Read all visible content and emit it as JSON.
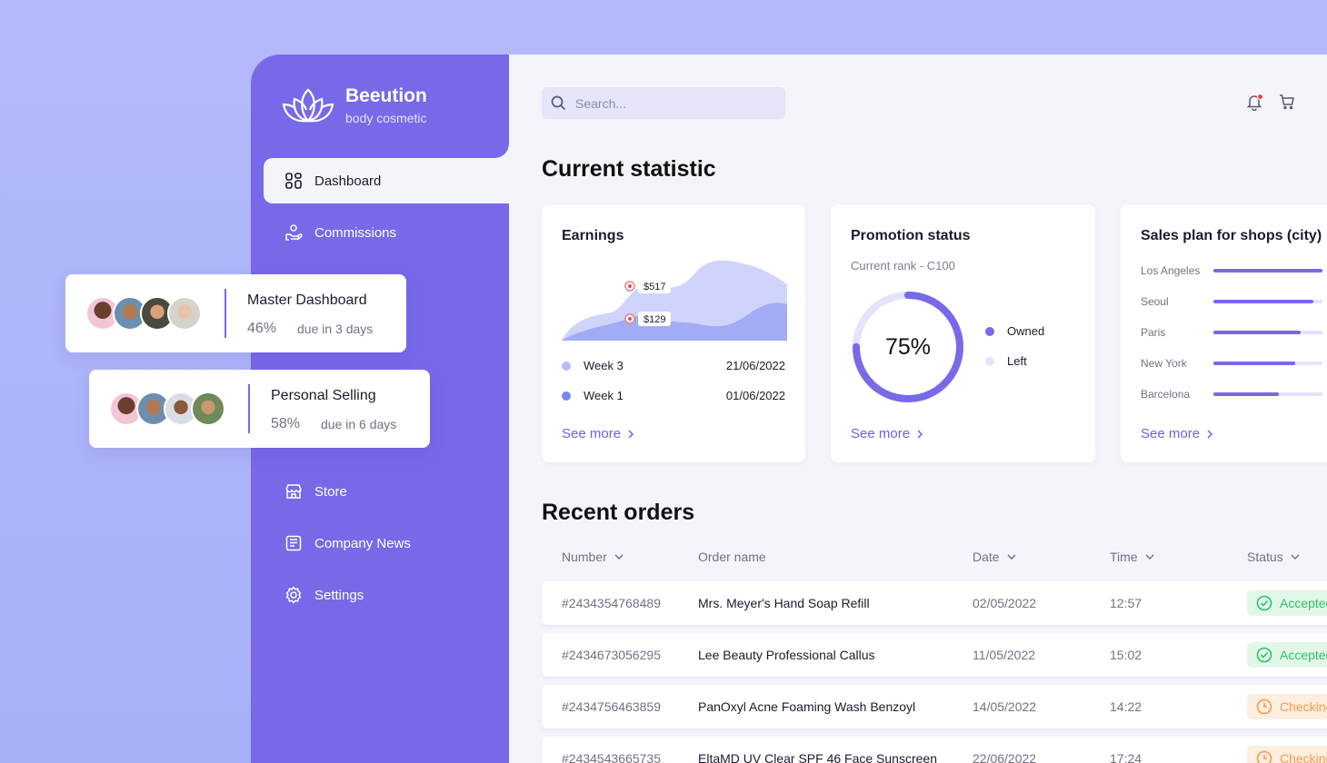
{
  "brand": {
    "name": "Beeution",
    "subtitle": "body cosmetic"
  },
  "sidebar": {
    "items": [
      {
        "label": "Dashboard",
        "icon": "grid-icon",
        "active": true
      },
      {
        "label": "Commissions",
        "icon": "hand-coins-icon"
      },
      {
        "label": "Store",
        "icon": "store-icon"
      },
      {
        "label": "Company News",
        "icon": "newspaper-icon"
      },
      {
        "label": "Settings",
        "icon": "gear-icon"
      }
    ]
  },
  "search": {
    "placeholder": "Search..."
  },
  "sections": {
    "statistic": "Current statistic",
    "orders": "Recent orders"
  },
  "earnings": {
    "title": "Earnings",
    "markers": [
      "$517",
      "$129"
    ],
    "legend": [
      {
        "label": "Week 3",
        "date": "21/06/2022",
        "color": "#b5bdf8"
      },
      {
        "label": "Week 1",
        "date": "01/06/2022",
        "color": "#7b86ee"
      }
    ],
    "see_more": "See more"
  },
  "promotion": {
    "title": "Promotion status",
    "subtitle": "Current rank - C100",
    "value_label": "75%",
    "value": 0.75,
    "legend": [
      {
        "label": "Owned",
        "color": "#7769e8"
      },
      {
        "label": "Left",
        "color": "#e5e3fb"
      }
    ],
    "see_more": "See more"
  },
  "sales": {
    "title": "Sales plan for shops (city)",
    "cities": [
      {
        "name": "Los Angeles",
        "progress": 1.0
      },
      {
        "name": "Seoul",
        "progress": 0.92
      },
      {
        "name": "Paris",
        "progress": 0.8
      },
      {
        "name": "New York",
        "progress": 0.75
      },
      {
        "name": "Barcelona",
        "progress": 0.6
      }
    ],
    "see_more": "See more"
  },
  "orders": {
    "headers": {
      "number": "Number",
      "name": "Order name",
      "date": "Date",
      "time": "Time",
      "status": "Status"
    },
    "rows": [
      {
        "number": "#2434354768489",
        "name": "Mrs. Meyer's Hand Soap Refill",
        "date": "02/05/2022",
        "time": "12:57",
        "status": "Accepted"
      },
      {
        "number": "#2434673056295",
        "name": "Lee Beauty Professional Callus",
        "date": "11/05/2022",
        "time": "15:02",
        "status": "Accepted"
      },
      {
        "number": "#2434756463859",
        "name": "PanOxyl Acne Foaming Wash Benzoyl",
        "date": "14/05/2022",
        "time": "14:22",
        "status": "Checking"
      },
      {
        "number": "#2434543665735",
        "name": "EltaMD UV Clear SPF 46 Face Sunscreen",
        "date": "22/06/2022",
        "time": "17:24",
        "status": "Checking"
      }
    ]
  },
  "floating_cards": [
    {
      "title": "Master Dashboard",
      "percent": "46%",
      "due": "due in 3 days"
    },
    {
      "title": "Personal Selling",
      "percent": "58%",
      "due": "due in 6 days"
    }
  ],
  "colors": {
    "accent": "#7769e8",
    "background": "#f3f5fa",
    "accepted": "#2fbf63",
    "checking": "#f59a4a"
  }
}
